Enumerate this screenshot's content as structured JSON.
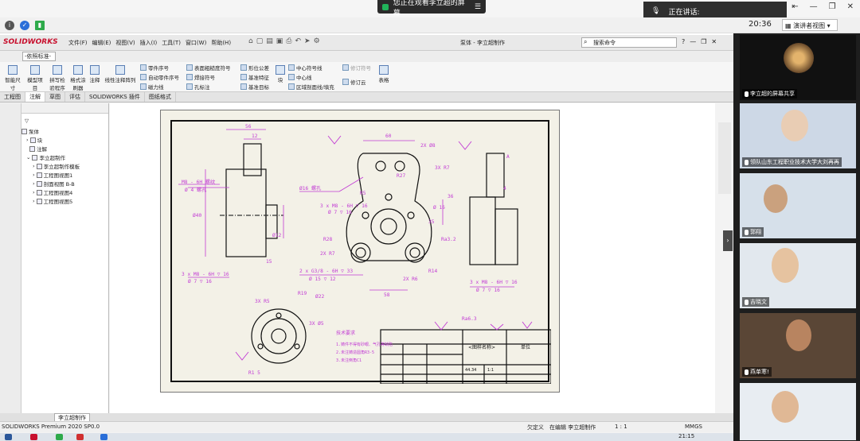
{
  "meeting": {
    "share_banner": "您正在观看李立超的屏幕",
    "speaking_label": "正在讲话:",
    "clock": "20:36",
    "presenter_view": "演讲者视图"
  },
  "sw": {
    "logo": "SOLIDWORKS",
    "menus": [
      "文件(F)",
      "编辑(E)",
      "视图(V)",
      "插入(I)",
      "工具(T)",
      "窗口(W)",
      "帮助(H)"
    ],
    "title": "泵体 - 李立超制作",
    "search_placeholder": "搜索命令",
    "std_dropdown": "-依照标准-",
    "ribbon": {
      "big": [
        "智能尺寸",
        "模型项目",
        "拼写检验程序",
        "格式涂刷器",
        "注释",
        "线性注释阵列"
      ],
      "small_col1": [
        "零件序号",
        "自动零件序号",
        "磁力线"
      ],
      "small_col2": [
        "表面粗糙度符号",
        "焊接符号",
        "孔标注"
      ],
      "small_col3": [
        "形位公差",
        "基准特征",
        "基准目标"
      ],
      "block": "块",
      "small_col4": [
        "中心符号线",
        "中心线",
        "区域剖面线/填充"
      ],
      "small_col5": [
        "修订符号",
        "修订云"
      ],
      "table": "表格"
    },
    "tabs": [
      "工程图",
      "注解",
      "草图",
      "评估",
      "SOLIDWORKS 插件",
      "图纸格式"
    ],
    "tree": {
      "root": "泵体",
      "items": [
        "块",
        "注解",
        "李立超制作",
        "李立超制作模板",
        "工程图视图1",
        "剖面视图 B-B",
        "工程图视图4",
        "工程图视图5"
      ]
    },
    "sheet_tab": "李立超制作",
    "status": {
      "app": "SOLIDWORKS Premium 2020 SP0.0",
      "state": "欠定义",
      "editing": "在编辑 李立超制作",
      "scale": "1 : 1",
      "units": "MMGS",
      "time": "21:15"
    }
  },
  "drawing": {
    "dims": [
      "56",
      "12",
      "M8 - 6H 螺纹",
      "Ø 4 螺孔",
      "Ø40",
      "Ø12",
      "15",
      "3 x M8 - 6H ▽ 16",
      "Ø 7 ▽ 16",
      "60",
      "2X Ø8",
      "Ø16 螺孔",
      "R27",
      "R5",
      "3X R7",
      "3 x M8 - 6H ▽ 16",
      "Ø 7 ▽ 16",
      "R28",
      "2X R7",
      "2 x G3/8 - 6H ▽ 33",
      "Ø 15 ▽ 12",
      "58",
      "2X R6",
      "R14",
      "Ø 16",
      "35",
      "36",
      "3X R5",
      "R19",
      "Ø22",
      "3X Ø5",
      "R1 5",
      "A",
      "4",
      "Ra3.2",
      "Ra6.3"
    ],
    "tech_req": "技术要求",
    "req_lines": [
      "1.铸件不得有砂眼、气孔等缺陷",
      "2.未注铸造圆角R3-5",
      "3.未注倒角C1"
    ],
    "title_text": "<图样名称>",
    "unit_text": "单位",
    "weight": "44.34",
    "scale_small": "1:1"
  },
  "participants": [
    {
      "name": "李立超的屏幕共享"
    },
    {
      "name": "领队山东工程职业技术大学大刘再再"
    },
    {
      "name": "郭翔"
    },
    {
      "name": "吉晓文"
    },
    {
      "name": "燕单寒!"
    },
    {
      "name": ""
    }
  ]
}
